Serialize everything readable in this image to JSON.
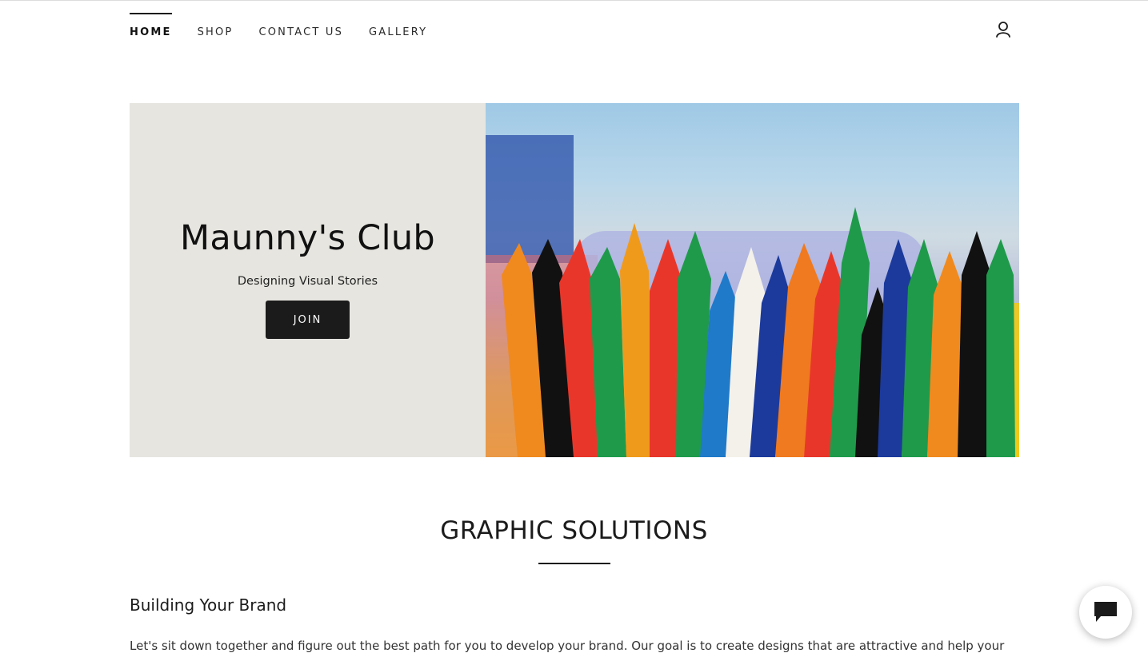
{
  "nav": {
    "items": [
      {
        "label": "HOME",
        "active": true
      },
      {
        "label": "SHOP",
        "active": false
      },
      {
        "label": "CONTACT US",
        "active": false
      },
      {
        "label": "GALLERY",
        "active": false
      }
    ],
    "account_icon": "user-icon"
  },
  "hero": {
    "title": "Maunny's Club",
    "subtitle": "Designing Visual Stories",
    "join_label": "JOIN",
    "panel_color": "#e6e5df"
  },
  "section": {
    "title": "GRAPHIC SOLUTIONS",
    "subheading": "Building Your Brand",
    "body": "Let's sit down together and figure out the best path for you to develop your brand. Our goal is to create designs that are attractive and help your"
  },
  "chat": {
    "icon": "chat-bubble-icon"
  },
  "colors": {
    "accent": "#1b1b1b",
    "background": "#ffffff"
  }
}
